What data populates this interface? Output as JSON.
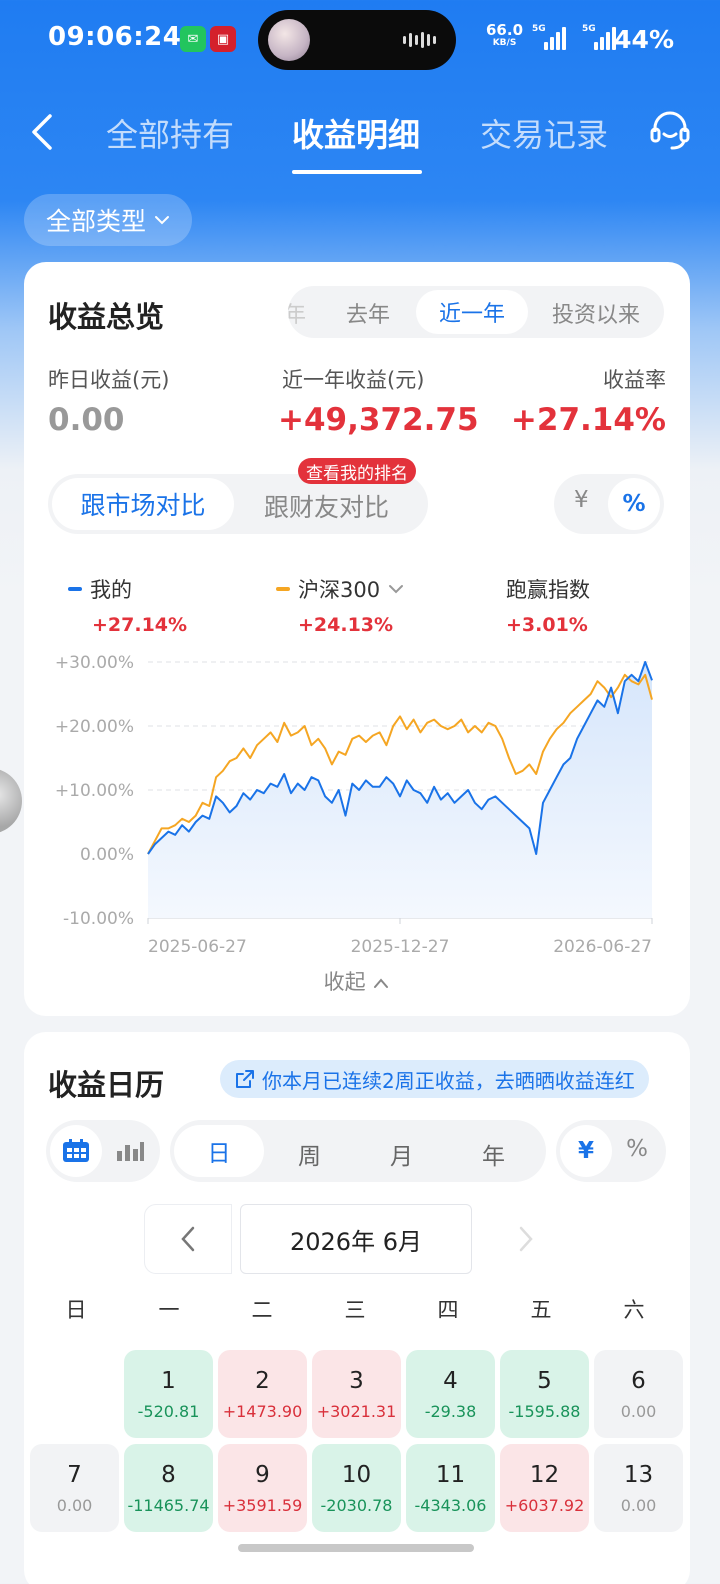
{
  "status": {
    "time": "09:06:24",
    "net_speed": "66.0",
    "net_unit": "KB/S",
    "sig1_label": "5G",
    "sig2_label": "5G",
    "battery": "44%"
  },
  "nav": {
    "tabs": [
      {
        "label": "全部持有"
      },
      {
        "label": "收益明细"
      },
      {
        "label": "交易记录"
      }
    ],
    "type_filter": "全部类型"
  },
  "overview": {
    "title": "收益总览",
    "periods": [
      "年",
      "去年",
      "近一年",
      "投资以来"
    ],
    "yesterday_label": "昨日收益(元)",
    "yesterday_value": "0.00",
    "year_label": "近一年收益(元)",
    "year_value": "+49,372.75",
    "rate_label": "收益率",
    "rate_value": "+27.14%",
    "compare_market": "跟市场对比",
    "compare_friends": "跟财友对比",
    "rank_badge": "查看我的排名",
    "unit_yuan": "¥",
    "unit_pct": "%",
    "legend": [
      {
        "name": "我的",
        "value": "+27.14%",
        "color": "#1a73e8"
      },
      {
        "name": "沪深300",
        "value": "+24.13%",
        "color": "#f5a623"
      },
      {
        "name": "跑赢指数",
        "value": "+3.01%"
      }
    ],
    "collapse": "收起"
  },
  "chart_data": {
    "type": "line",
    "x_ticks": [
      "2025-06-27",
      "2025-12-27",
      "2026-06-27"
    ],
    "y_ticks": [
      "+30.00%",
      "+20.00%",
      "+10.00%",
      "0.00%",
      "-10.00%"
    ],
    "ylim": [
      -10,
      30
    ],
    "grid": true,
    "series": [
      {
        "name": "我的",
        "color": "#1a73e8",
        "values": [
          0,
          1.5,
          2.5,
          3.5,
          3,
          4.5,
          3.5,
          5,
          6,
          5.5,
          9,
          8,
          6.5,
          7.5,
          9.5,
          8.5,
          10,
          9.5,
          11,
          10.5,
          12.5,
          9.5,
          11,
          10,
          12,
          11.5,
          9,
          8,
          10,
          6,
          11,
          10,
          11.5,
          10.5,
          10.5,
          12,
          11,
          9,
          11.5,
          10,
          9.5,
          8,
          10.5,
          8.5,
          9.5,
          8,
          9,
          10,
          8,
          7,
          8.5,
          9,
          8,
          7,
          6,
          5,
          4,
          0,
          8,
          10,
          12,
          14,
          15,
          18,
          20,
          22,
          24,
          23,
          26,
          22,
          27,
          28,
          27,
          30,
          27.14
        ]
      },
      {
        "name": "沪深300",
        "color": "#f5a623",
        "values": [
          0,
          2,
          4,
          4,
          4.5,
          5.5,
          5,
          6,
          8,
          7.5,
          12,
          13,
          14.5,
          15,
          16.5,
          15,
          17,
          18,
          19,
          17.5,
          20.5,
          18.5,
          19,
          20,
          17,
          18,
          16.5,
          14,
          16,
          15.5,
          18,
          18.5,
          17.5,
          18.5,
          19,
          17,
          20,
          21.5,
          19.5,
          21,
          19,
          20.5,
          21,
          20,
          19.5,
          20,
          21,
          19,
          20,
          19,
          20.5,
          20,
          18,
          15,
          12.5,
          13,
          14,
          12.5,
          16,
          18,
          19.5,
          20.5,
          22,
          23,
          24,
          25,
          27,
          26,
          24.5,
          26,
          28,
          27,
          26.5,
          28,
          24.13
        ]
      }
    ]
  },
  "calendar": {
    "title": "收益日历",
    "streak_text": "你本月已连续2周正收益，去晒晒收益连红",
    "granularity": [
      "日",
      "周",
      "月",
      "年"
    ],
    "unit_yuan": "¥",
    "unit_pct": "%",
    "month_label": "2026年 6月",
    "weekdays": [
      "日",
      "一",
      "二",
      "三",
      "四",
      "五",
      "六"
    ],
    "days": [
      {
        "day": "1",
        "value": "-520.81",
        "tone": "g"
      },
      {
        "day": "2",
        "value": "+1473.90",
        "tone": "r"
      },
      {
        "day": "3",
        "value": "+3021.31",
        "tone": "r"
      },
      {
        "day": "4",
        "value": "-29.38",
        "tone": "g"
      },
      {
        "day": "5",
        "value": "-1595.88",
        "tone": "g"
      },
      {
        "day": "6",
        "value": "0.00",
        "tone": "n"
      },
      {
        "day": "7",
        "value": "0.00",
        "tone": "n"
      },
      {
        "day": "8",
        "value": "-11465.74",
        "tone": "g"
      },
      {
        "day": "9",
        "value": "+3591.59",
        "tone": "r"
      },
      {
        "day": "10",
        "value": "-2030.78",
        "tone": "g"
      },
      {
        "day": "11",
        "value": "-4343.06",
        "tone": "g"
      },
      {
        "day": "12",
        "value": "+6037.92",
        "tone": "r"
      },
      {
        "day": "13",
        "value": "0.00",
        "tone": "n"
      }
    ]
  }
}
